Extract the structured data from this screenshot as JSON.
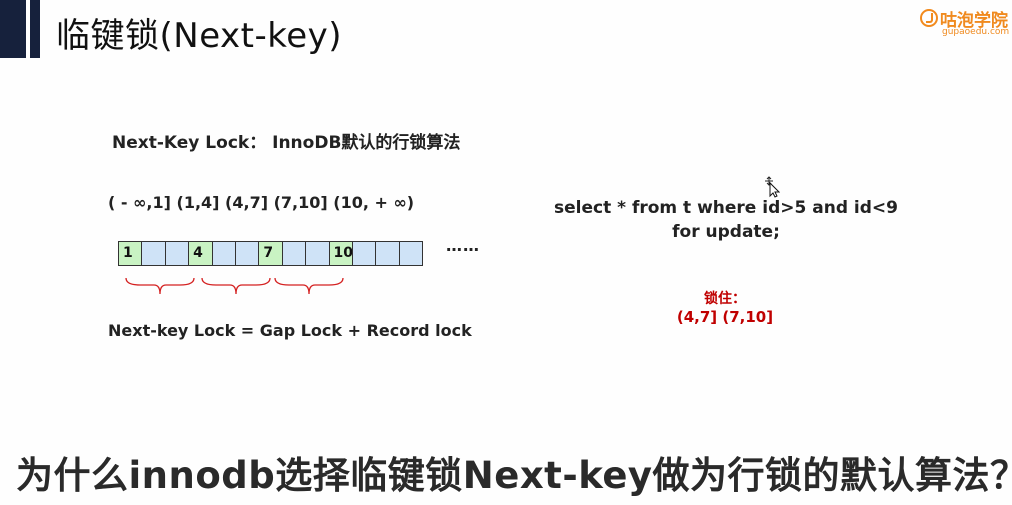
{
  "slide": {
    "title": "临键锁(Next-key)",
    "heading": "Next-Key Lock： InnoDB默认的行锁算法",
    "intervals": "( - ∞,1] (1,4] (4,7] (7,10] (10, + ∞)",
    "cells": [
      "1",
      "",
      "",
      "4",
      "",
      "",
      "7",
      "",
      "",
      "10",
      "",
      "",
      ""
    ],
    "record_cells": [
      0,
      3,
      6,
      9
    ],
    "ellipsis": "……",
    "formula": "Next-key Lock = Gap Lock + Record lock",
    "sql_line1": "select * from t where id>5 and id<9",
    "sql_line2": "for update;",
    "lock_label": "锁住：",
    "lock_ranges": "(4,7] (7,10]"
  },
  "logo": {
    "name": "咕泡学院",
    "url": "gupaoedu.com"
  },
  "subtitle": "为什么innodb选择临键锁Next-key做为行锁的默认算法？",
  "colors": {
    "title_bar": "#16213c",
    "brand": "#f08a1e",
    "record_cell": "#c9f3c3",
    "gap_cell": "#cfe3f7",
    "lock_text": "#c00000",
    "brace": "#d42020"
  },
  "icons": {
    "cursor": "move-cursor-icon"
  }
}
